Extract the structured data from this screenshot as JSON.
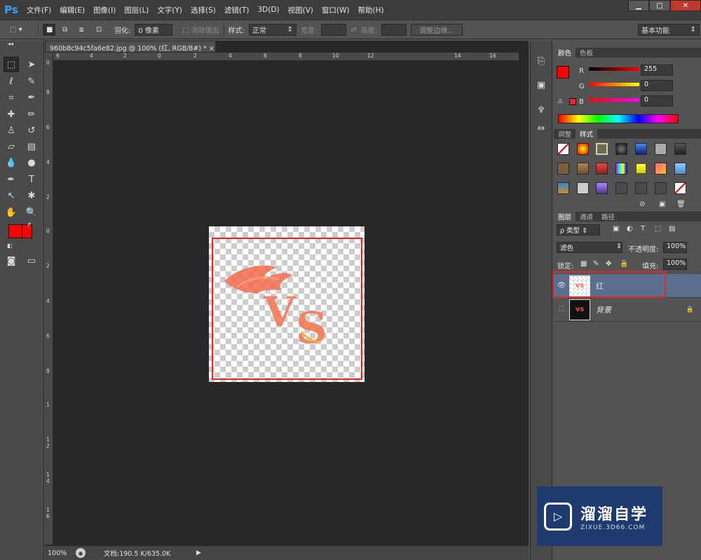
{
  "app_logo": "Ps",
  "menu": [
    "文件(F)",
    "编辑(E)",
    "图像(I)",
    "图层(L)",
    "文字(Y)",
    "选择(S)",
    "滤镜(T)",
    "3D(D)",
    "视图(V)",
    "窗口(W)",
    "帮助(H)"
  ],
  "window_controls": {
    "minimize": "▁",
    "restore": "□",
    "close": "✕"
  },
  "options": {
    "feather_label": "羽化:",
    "feather_value": "0 像素",
    "antialias_label": "消除锯齿",
    "style_label": "样式:",
    "style_value": "正常",
    "width_label": "宽度:",
    "height_label": "高度:",
    "refine_edge": "调整边缘...",
    "workspace": "基本功能"
  },
  "document": {
    "tab_title": "960b8c94c5fa6e82.jpg @ 100% (红, RGB/8#) *",
    "tab_close": "×",
    "hruler": [
      "6",
      "4",
      "2",
      "0",
      "2",
      "4",
      "6",
      "8",
      "10",
      "12",
      "14",
      "16"
    ],
    "vruler": [
      "0",
      "8",
      "6",
      "4",
      "2",
      "0",
      "2",
      "4",
      "6",
      "8",
      "1",
      "1 2",
      "1 4",
      "1 6"
    ],
    "zoom": "100%",
    "doc_info": "文档:190.5 K/635.0K"
  },
  "color_panel": {
    "tabs": [
      "颜色",
      "色板"
    ],
    "r_label": "R",
    "g_label": "G",
    "b_label": "B",
    "r_value": "255",
    "g_value": "0",
    "b_value": "0"
  },
  "styles_panel": {
    "tabs": [
      "调整",
      "样式"
    ]
  },
  "layers_panel": {
    "tabs": [
      "图层",
      "通道",
      "路径"
    ],
    "filter_label": "ρ 类型",
    "blend_mode": "滤色",
    "opacity_label": "不透明度:",
    "opacity_value": "100%",
    "lock_label": "锁定:",
    "fill_label": "填充:",
    "fill_value": "100%",
    "layers": [
      {
        "name": "红"
      },
      {
        "name": "背景"
      }
    ]
  },
  "watermark": {
    "title": "溜溜自学",
    "url": "ZIXUE.3D66.COM"
  },
  "colors": {
    "foreground": "#ff0000",
    "background": "#ff0000",
    "selection_highlight": "#e0281e",
    "layer_selected": "#5a6f8e"
  }
}
